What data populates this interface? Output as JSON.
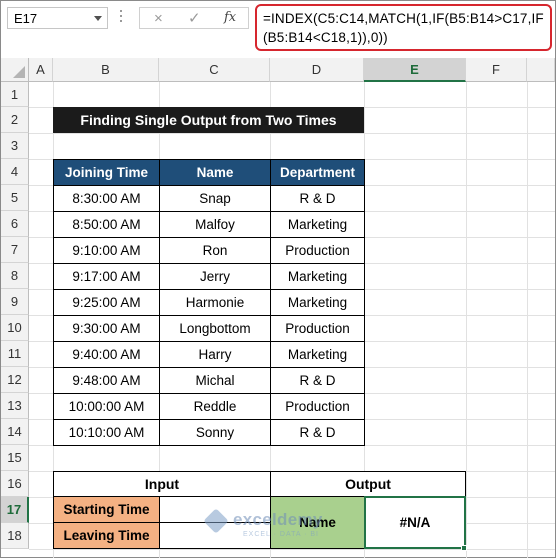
{
  "formula_bar": {
    "name_box": "E17",
    "cancel_icon": "×",
    "enter_icon": "✓",
    "fx_label": "fx",
    "formula": "=INDEX(C5:C14,MATCH(1,IF(B5:B14>C17,IF(B5:B14<C18,1)),0))"
  },
  "columns": [
    "A",
    "B",
    "C",
    "D",
    "E",
    "F"
  ],
  "active_column": "E",
  "rows": [
    "1",
    "2",
    "3",
    "4",
    "5",
    "6",
    "7",
    "8",
    "9",
    "10",
    "11",
    "12",
    "13",
    "14",
    "15",
    "16",
    "17",
    "18"
  ],
  "active_row": "17",
  "title": "Finding Single Output from Two Times",
  "table": {
    "headers": [
      "Joining Time",
      "Name",
      "Department"
    ],
    "rows": [
      [
        "8:30:00 AM",
        "Snap",
        "R & D"
      ],
      [
        "8:50:00 AM",
        "Malfoy",
        "Marketing"
      ],
      [
        "9:10:00 AM",
        "Ron",
        "Production"
      ],
      [
        "9:17:00 AM",
        "Jerry",
        "Marketing"
      ],
      [
        "9:25:00 AM",
        "Harmonie",
        "Marketing"
      ],
      [
        "9:30:00 AM",
        "Longbottom",
        "Production"
      ],
      [
        "9:40:00 AM",
        "Harry",
        "Marketing"
      ],
      [
        "9:48:00 AM",
        "Michal",
        "R & D"
      ],
      [
        "10:00:00 AM",
        "Reddle",
        "Production"
      ],
      [
        "10:10:00 AM",
        "Sonny",
        "R & D"
      ]
    ]
  },
  "input": {
    "header": "Input",
    "starting_label": "Starting Time",
    "starting_value": "",
    "leaving_label": "Leaving Time",
    "leaving_value": ""
  },
  "output": {
    "header": "Output",
    "name_label": "Name",
    "result": "#N/A"
  },
  "watermark": {
    "name": "exceldemy",
    "sub": "EXCEL · DATA · BI"
  },
  "colors": {
    "header_blue": "#1f4e79",
    "input_orange": "#f4b183",
    "output_green": "#a9d08e",
    "selection_green": "#217346",
    "formula_border": "#d6262e"
  }
}
